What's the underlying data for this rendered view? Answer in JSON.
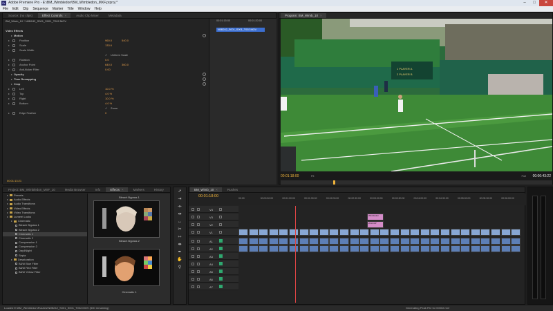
{
  "window": {
    "title": "Adobe Premiere Pro - E:\\BM_Wimbledon\\BM_Wimbledon_MXF.prproj *",
    "app_icon": "Pr",
    "controls": [
      "–",
      "□",
      "✕"
    ]
  },
  "menu": [
    "File",
    "Edit",
    "Clip",
    "Sequence",
    "Marker",
    "Title",
    "Window",
    "Help"
  ],
  "effect_controls": {
    "tabs": [
      {
        "label": "Source: (no clips)",
        "active": false
      },
      {
        "label": "Effect Controls",
        "active": true
      },
      {
        "label": "Audio Clip Mixer",
        "active": false
      },
      {
        "label": "Metadata",
        "active": false
      }
    ],
    "breadcrumb": "BM_Wimb_10 * N0B242_S001_S001_T002.MOV",
    "timecode_start": "00:01:15:00",
    "timecode_end": "00:01:20:00",
    "clip_label": "N0B242_S001_S001_T002.MOV",
    "section": "Video Effects",
    "rows": [
      {
        "type": "fx",
        "label": "Motion"
      },
      {
        "type": "param",
        "label": "Position",
        "v1": "960.0",
        "v2": "540.0"
      },
      {
        "type": "param",
        "label": "Scale",
        "v1": "133.6",
        "v2": ""
      },
      {
        "type": "param",
        "label": "Scale Width",
        "v1": "",
        "v2": ""
      },
      {
        "type": "check",
        "label": "Uniform Scale"
      },
      {
        "type": "param",
        "label": "Rotation",
        "v1": "0.0",
        "v2": ""
      },
      {
        "type": "param",
        "label": "Anchor Point",
        "v1": "640.0",
        "v2": "360.0"
      },
      {
        "type": "param",
        "label": "Anti-flicker Filter",
        "v1": "0.00",
        "v2": ""
      },
      {
        "type": "fx",
        "label": "Opacity"
      },
      {
        "type": "fx",
        "label": "Time Remapping"
      },
      {
        "type": "fx",
        "label": "Crop"
      },
      {
        "type": "param",
        "label": "Left",
        "v1": "10.0 %",
        "v2": ""
      },
      {
        "type": "param",
        "label": "Top",
        "v1": "4.0 %",
        "v2": ""
      },
      {
        "type": "param",
        "label": "Right",
        "v1": "10.0 %",
        "v2": ""
      },
      {
        "type": "param",
        "label": "Bottom",
        "v1": "4.0 %",
        "v2": ""
      },
      {
        "type": "check",
        "label": "Zoom"
      },
      {
        "type": "param",
        "label": "Edge Feather",
        "v1": "0",
        "v2": ""
      }
    ],
    "footer_timecode": "00:01:13:21"
  },
  "program_monitor": {
    "tab": "Program: BM_Wimb_10",
    "timecode_current": "00:01:18:00",
    "fit": "Fit",
    "full": "Full",
    "timecode_duration": "00:06:43:22",
    "scoreboard": [
      "1 PLAYER A",
      "2 PLAYER B"
    ],
    "transport": [
      "▼",
      "{",
      "}",
      "⇤",
      "◀|",
      "▶",
      "|▶",
      "⇥",
      "⬒",
      "⬓",
      "▣",
      "▣"
    ]
  },
  "project": {
    "tabs": [
      {
        "label": "Project: BM_Wimbledon_MXF_10",
        "active": false
      },
      {
        "label": "Media Browser",
        "active": false
      },
      {
        "label": "Info",
        "active": false
      },
      {
        "label": "Effects",
        "active": true
      },
      {
        "label": "Markers",
        "active": false
      },
      {
        "label": "History",
        "active": false
      }
    ],
    "tree": [
      {
        "label": "Presets",
        "depth": 0,
        "kind": "folder"
      },
      {
        "label": "Audio Effects",
        "depth": 0,
        "kind": "folder"
      },
      {
        "label": "Audio Transitions",
        "depth": 0,
        "kind": "folder"
      },
      {
        "label": "Video Effects",
        "depth": 0,
        "kind": "folder"
      },
      {
        "label": "Video Transitions",
        "depth": 0,
        "kind": "folder"
      },
      {
        "label": "Lumetri Looks",
        "depth": 0,
        "kind": "folder"
      },
      {
        "label": "Cinematic",
        "depth": 1,
        "kind": "folder"
      },
      {
        "label": "Bleach Bypass 1",
        "depth": 2,
        "kind": "preset"
      },
      {
        "label": "Bleach Bypass 2",
        "depth": 2,
        "kind": "preset"
      },
      {
        "label": "Cinematic 1",
        "depth": 2,
        "kind": "preset",
        "selected": true
      },
      {
        "label": "Cinematic 2",
        "depth": 2,
        "kind": "preset"
      },
      {
        "label": "Compression 1",
        "depth": 2,
        "kind": "preset"
      },
      {
        "label": "Compression 2",
        "depth": 2,
        "kind": "preset"
      },
      {
        "label": "Day4Night",
        "depth": 2,
        "kind": "preset"
      },
      {
        "label": "Sepia",
        "depth": 2,
        "kind": "preset"
      },
      {
        "label": "Desaturation",
        "depth": 1,
        "kind": "folder"
      },
      {
        "label": "B&W Blue Filter",
        "depth": 2,
        "kind": "preset"
      },
      {
        "label": "B&W Red Filter",
        "depth": 2,
        "kind": "preset"
      },
      {
        "label": "B&W Yellow Filter",
        "depth": 2,
        "kind": "preset"
      }
    ],
    "preview_captions": [
      "Bleach Bypass 1",
      "Bleach Bypass 2",
      "Cinematic 1"
    ]
  },
  "timeline": {
    "tabs": [
      {
        "label": "BM_Wimb_10",
        "active": true
      },
      {
        "label": "Rushes",
        "active": false
      }
    ],
    "timecode": "00:01:18:00",
    "ruler": [
      "00:00",
      "00:00:30:00",
      "00:01:00:00",
      "00:01:30:00",
      "00:02:00:00",
      "00:02:30:00",
      "00:03:00:00",
      "00:03:30:00",
      "00:04:00:00",
      "00:04:30:00",
      "00:05:00:00",
      "00:05:30:00",
      "00:06:00:00"
    ],
    "video_tracks": [
      "V4",
      "V3",
      "V2",
      "V1"
    ],
    "audio_tracks": [
      "A1",
      "A2",
      "A3",
      "A4",
      "A5",
      "A6",
      "A7"
    ],
    "title_clips": [
      "Wimbledon",
      "Title 01",
      "2013 RP"
    ]
  },
  "status": {
    "left": "Loaded E:\\BM_Wimbledon\\Rushes\\N0B242_S001_S001_T002.MOV (500 remaining)",
    "right": "Generating Peak File for 00002.mxf"
  },
  "colors": {
    "accent_timecode": "#f0b43c",
    "param_value": "#e8a04c",
    "clip_video": "#88a7d4",
    "clip_audio": "#5d7fb6",
    "clip_title": "#d48cc8",
    "playhead": "#dd4444"
  }
}
